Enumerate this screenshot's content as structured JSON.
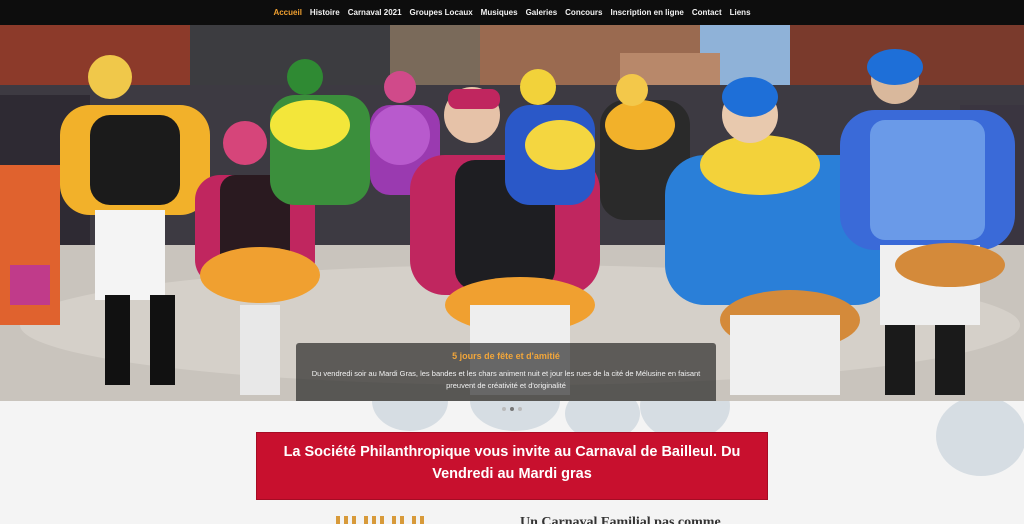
{
  "nav": {
    "items": [
      {
        "label": "Accueil",
        "active": true
      },
      {
        "label": "Histoire",
        "active": false
      },
      {
        "label": "Carnaval 2021",
        "active": false
      },
      {
        "label": "Groupes Locaux",
        "active": false
      },
      {
        "label": "Musiques",
        "active": false
      },
      {
        "label": "Galeries",
        "active": false
      },
      {
        "label": "Concours",
        "active": false
      },
      {
        "label": "Inscription en ligne",
        "active": false
      },
      {
        "label": "Contact",
        "active": false
      },
      {
        "label": "Liens",
        "active": false
      }
    ]
  },
  "hero": {
    "caption_title": "5 jours de fête et d'amitié",
    "caption_text": "Du vendredi soir au Mardi Gras, les bandes et les chars animent nuit et jour les rues de la cité de Mélusine en faisant preuvent de créativité et d'originalité",
    "slides": 3,
    "active_slide": 2
  },
  "banner": {
    "text": "La Société Philanthropique vous invite au Carnaval de Bailleul. Du Vendredi au Mardi gras"
  },
  "section": {
    "heading": "Un Carnaval Familial pas comme"
  },
  "colors": {
    "accent": "#f0a030",
    "banner": "#c8102e",
    "nav_bg": "#0d0d0d"
  }
}
